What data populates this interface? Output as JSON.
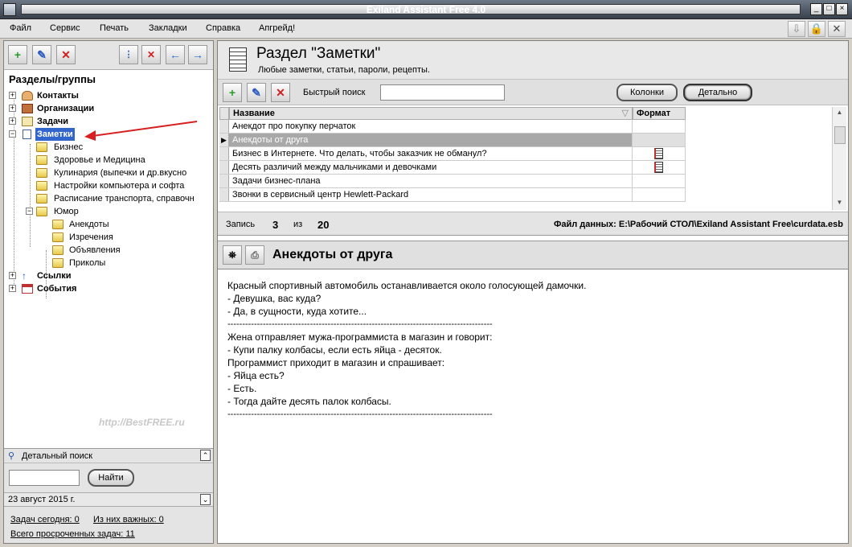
{
  "window": {
    "title": "Exiland Assistant Free 4.0"
  },
  "menu": [
    "Файл",
    "Сервис",
    "Печать",
    "Закладки",
    "Справка",
    "Апгрейд!"
  ],
  "left": {
    "groups_title": "Разделы/группы",
    "tree": [
      {
        "label": "Контакты",
        "bold": true
      },
      {
        "label": "Организации",
        "bold": true
      },
      {
        "label": "Задачи",
        "bold": true
      },
      {
        "label": "Заметки",
        "bold": true,
        "selected": true
      },
      {
        "label": "Бизнес"
      },
      {
        "label": "Здоровье и Медицина"
      },
      {
        "label": "Кулинария (выпечки и др.вкусно"
      },
      {
        "label": "Настройки компьютера и софта"
      },
      {
        "label": "Расписание транспорта, справочн"
      },
      {
        "label": "Юмор"
      },
      {
        "label": "Анекдоты"
      },
      {
        "label": "Изречения"
      },
      {
        "label": "Объявления"
      },
      {
        "label": "Приколы"
      },
      {
        "label": "Ссылки",
        "bold": true
      },
      {
        "label": "События",
        "bold": true
      }
    ],
    "watermark": "http://BestFREE.ru",
    "detailed_search": "Детальный поиск",
    "find_button": "Найти",
    "date": "23 август 2015 г.",
    "tasks_today": "Задач сегодня: 0",
    "tasks_important": "Из них важных: 0",
    "tasks_overdue": "Всего просроченных задач: 11"
  },
  "main": {
    "title": "Раздел \"Заметки\"",
    "subtitle": "Любые заметки, статьи, пароли, рецепты.",
    "quick_search_label": "Быстрый поиск",
    "quick_search_value": "",
    "columns_button": "Колонки",
    "detail_button": "Детально",
    "grid_headers": {
      "name": "Название",
      "format": "Формат"
    },
    "rows": [
      {
        "name": "Анекдот про покупку перчаток",
        "format": ""
      },
      {
        "name": "Анекдоты от друга",
        "format": "",
        "selected": true
      },
      {
        "name": "Бизнес в Интернете. Что делать, чтобы заказчик не обманул?",
        "format": "doc-icon"
      },
      {
        "name": "Десять различий между мальчиками и девочками",
        "format": "doc-icon"
      },
      {
        "name": "Задачи бизнес-плана",
        "format": ""
      },
      {
        "name": "Звонки в сервисный центр Hewlett-Packard",
        "format": ""
      }
    ],
    "record_label": "Запись",
    "record_current": "3",
    "record_of": "из",
    "record_total": "20",
    "datafile": "Файл данных: E:\\Рабочий СТОЛ\\Exiland Assistant Free\\curdata.esb",
    "note_title": "Анекдоты от друга",
    "note_lines": [
      "Красный спортивный автомобиль останавливается около голосующей дамочки.",
      "- Девушка, вас куда?",
      "- Да, в сущности, куда хотите...",
      "------------------------------------------------------------------------------------------",
      "Жена отправляет мужа-программиста в магазин и говорит:",
      "- Купи палку колбасы, если есть яйца - десяток.",
      "Программист приходит в магазин и спрашивает:",
      "- Яйца есть?",
      "- Есть.",
      "- Тогда дайте десять палок колбасы.",
      "------------------------------------------------------------------------------------------"
    ]
  }
}
